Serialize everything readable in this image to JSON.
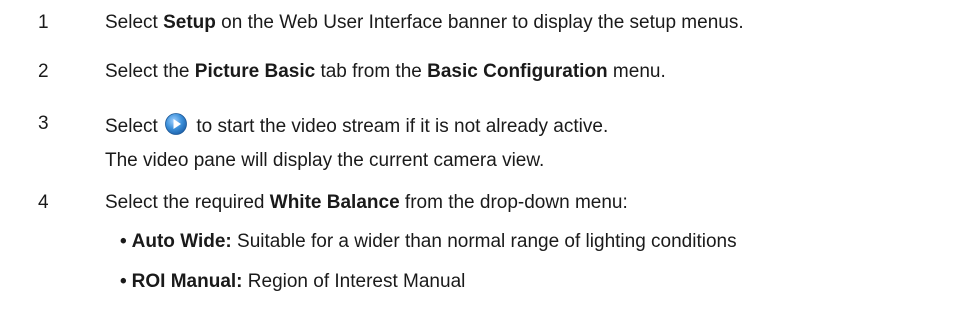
{
  "steps": [
    {
      "number": "1",
      "pre": "Select ",
      "bold1": "Setup",
      "post": " on the Web User Interface banner to display the setup menus."
    },
    {
      "number": "2",
      "pre": "Select the ",
      "bold1": "Picture Basic",
      "mid": " tab from the ",
      "bold2": "Basic Configuration",
      "post": " menu."
    },
    {
      "number": "3",
      "pre": "Select",
      "icon": "play-button-icon",
      "post": "to start the video stream if it is not already active.",
      "note": "The video pane will display the current camera view."
    },
    {
      "number": "4",
      "pre": "Select the required ",
      "bold1": "White Balance",
      "post": " from the drop-down menu:",
      "bullets": [
        {
          "marker": "•",
          "term": "Auto Wide:",
          "desc": " Suitable for a wider than normal range of lighting conditions"
        },
        {
          "marker": "•",
          "term": "ROI Manual:",
          "desc": " Region of Interest Manual"
        }
      ]
    }
  ],
  "colors": {
    "text": "#1a1a1a",
    "icon_blue": "#3b8fd9"
  }
}
